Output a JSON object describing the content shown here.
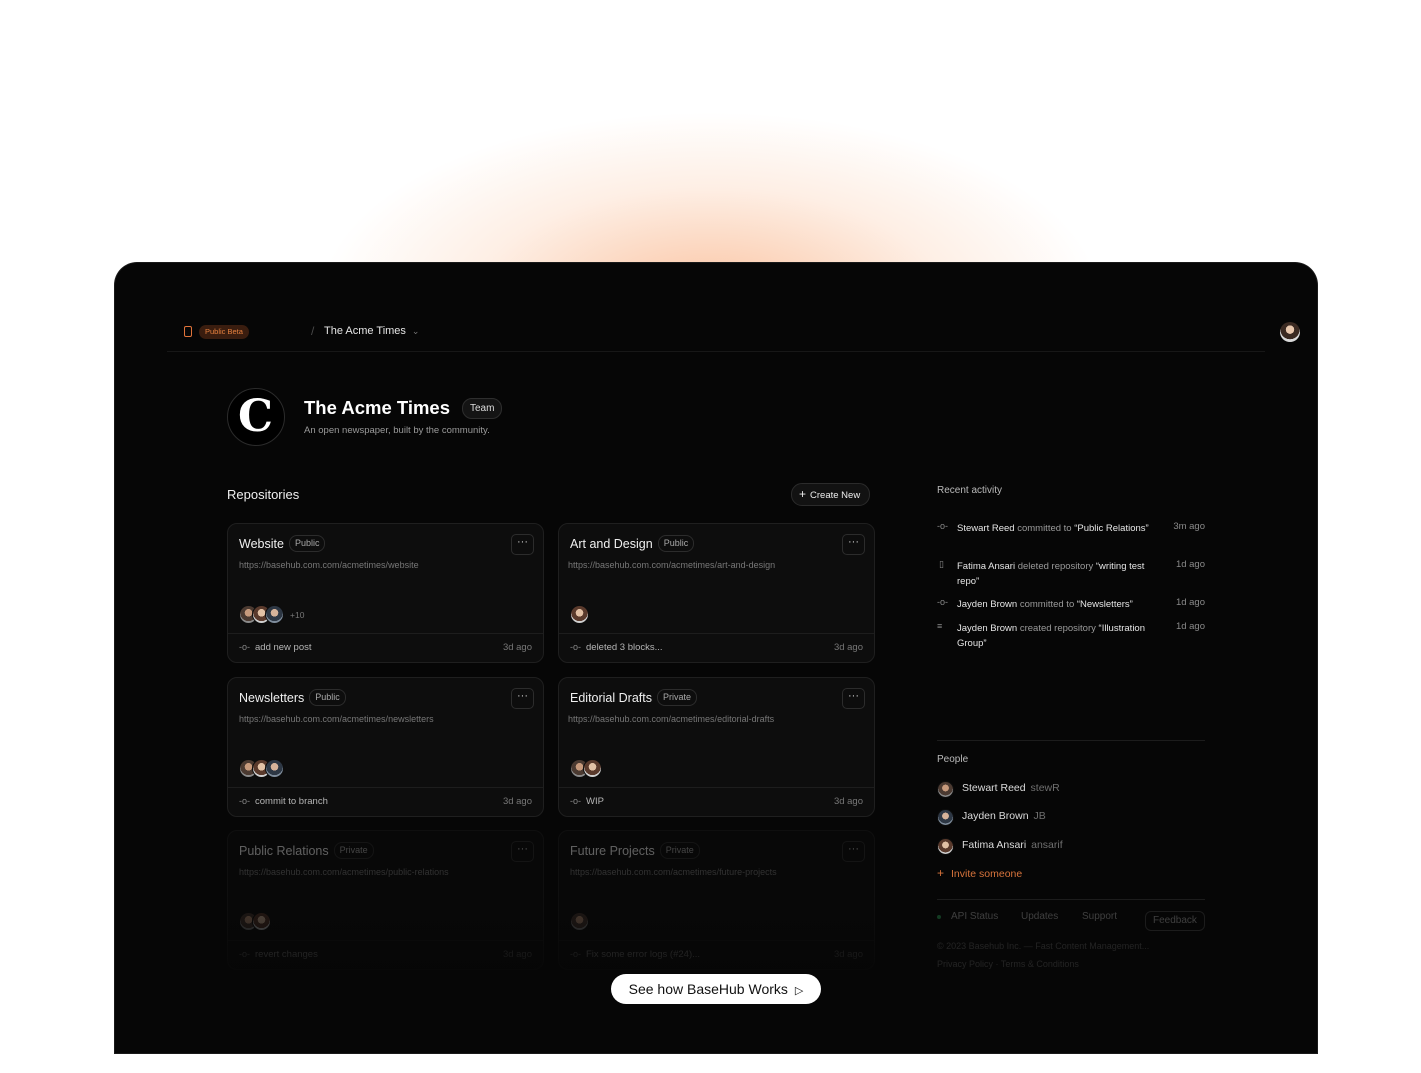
{
  "header": {
    "beta_label": "Public Beta",
    "separator": "/",
    "org_name": "The Acme Times"
  },
  "org": {
    "logo_letter": "C",
    "title": "The Acme Times",
    "badge": "Team",
    "description": "An open newspaper, built by the community."
  },
  "repositories": {
    "heading": "Repositories",
    "create_label": "Create New",
    "items": [
      {
        "name": "Website",
        "visibility": "Public",
        "url": "https://basehub.com.com/acmetimes/website",
        "extra": "+10",
        "commit": "add new post",
        "time": "3d ago"
      },
      {
        "name": "Art and Design",
        "visibility": "Public",
        "url": "https://basehub.com.com/acmetimes/art-and-design",
        "commit": "deleted 3 blocks...",
        "time": "3d ago"
      },
      {
        "name": "Newsletters",
        "visibility": "Public",
        "url": "https://basehub.com.com/acmetimes/newsletters",
        "commit": "commit to branch",
        "time": "3d ago"
      },
      {
        "name": "Editorial Drafts",
        "visibility": "Private",
        "url": "https://basehub.com.com/acmetimes/editorial-drafts",
        "commit": "WIP",
        "time": "3d ago"
      },
      {
        "name": "Public Relations",
        "visibility": "Private",
        "url": "https://basehub.com.com/acmetimes/public-relations",
        "commit": "revert changes",
        "time": "3d ago"
      },
      {
        "name": "Future Projects",
        "visibility": "Private",
        "url": "https://basehub.com.com/acmetimes/future-projects",
        "commit": "Fix some error logs (#24)...",
        "time": "3d ago"
      }
    ],
    "menu_glyph": "···"
  },
  "cta": {
    "label": "See how BaseHub Works"
  },
  "activity": {
    "heading": "Recent activity",
    "items": [
      {
        "actor": "Stewart Reed",
        "action": " committed to ",
        "target": "“Public Relations”",
        "time": "3m ago"
      },
      {
        "actor": "Fatima Ansari",
        "action": " deleted repository ",
        "target": "“writing test repo”",
        "time": "1d ago"
      },
      {
        "actor": "Jayden Brown",
        "action": " committed to ",
        "target": "“Newsletters”",
        "time": "1d ago"
      },
      {
        "actor": "Jayden Brown",
        "action": " created repository ",
        "target": "“Illustration Group”",
        "time": "1d ago"
      }
    ]
  },
  "people": {
    "heading": "People",
    "items": [
      {
        "name": "Stewart Reed",
        "handle": "stewR"
      },
      {
        "name": "Jayden Brown",
        "handle": "JB"
      },
      {
        "name": "Fatima Ansari",
        "handle": "ansarif"
      }
    ],
    "invite_label": "Invite someone"
  },
  "footer": {
    "status": "API Status",
    "updates": "Updates",
    "support": "Support",
    "feedback": "Feedback",
    "copyright": "© 2023 Basehub Inc. — Fast Content Management...",
    "privacy": "Privacy Policy",
    "terms": "Terms & Conditions"
  },
  "colors": {
    "accent": "#e6813f",
    "background": "#060606",
    "card": "#0d0d0d"
  }
}
